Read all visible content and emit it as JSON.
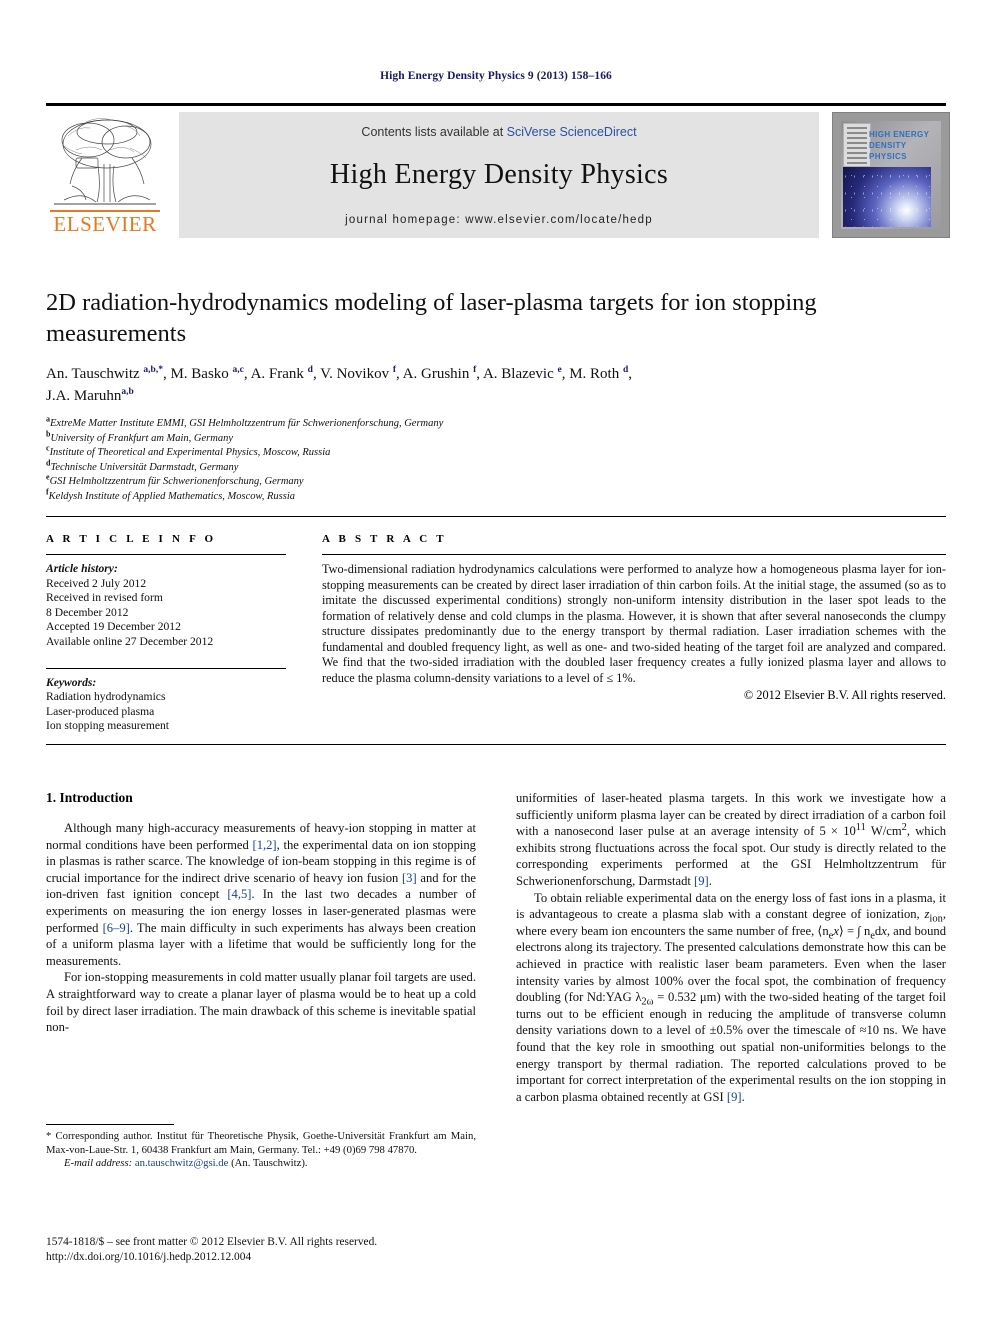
{
  "running_head": "High Energy Density Physics 9 (2013) 158–166",
  "masthead": {
    "contents_prefix": "Contents lists available at ",
    "sciencedirect": "SciVerse ScienceDirect",
    "journal_name": "High Energy Density Physics",
    "homepage": "journal homepage: www.elsevier.com/locate/hedp",
    "publisher_logo_text": "ELSEVIER",
    "cover_title_line1": "HIGH ENERGY",
    "cover_title_line2": "DENSITY PHYSICS",
    "accent_orange": "#E87722",
    "link_blue": "#2a4fa2"
  },
  "article": {
    "title": "2D radiation-hydrodynamics modeling of laser-plasma targets for ion stopping measurements",
    "authors_line1_html": "An. Tauschwitz <sup>a,b,*</sup>, M. Basko <sup>a,c</sup>, A. Frank <sup>d</sup>, V. Novikov <sup>f</sup>, A. Grushin <sup>f</sup>, A. Blazevic <sup>e</sup>, M. Roth <sup>d</sup>,",
    "authors_line2_html": "J.A. Maruhn<sup>a,b</sup>",
    "affiliations": [
      {
        "mark": "a",
        "text": "ExtreMe Matter Institute EMMI, GSI Helmholtzzentrum für Schwerionenforschung, Germany"
      },
      {
        "mark": "b",
        "text": "University of Frankfurt am Main, Germany"
      },
      {
        "mark": "c",
        "text": "Institute of Theoretical and Experimental Physics, Moscow, Russia"
      },
      {
        "mark": "d",
        "text": "Technische Universität Darmstadt, Germany"
      },
      {
        "mark": "e",
        "text": "GSI Helmholtzzentrum für Schwerionenforschung, Germany"
      },
      {
        "mark": "f",
        "text": "Keldysh Institute of Applied Mathematics, Moscow, Russia"
      }
    ]
  },
  "article_info": {
    "heading": "A R T I C L E   I N F O",
    "history_label": "Article history:",
    "history": [
      "Received 2 July 2012",
      "Received in revised form",
      "8 December 2012",
      "Accepted 19 December 2012",
      "Available online 27 December 2012"
    ],
    "keywords_label": "Keywords:",
    "keywords": [
      "Radiation hydrodynamics",
      "Laser-produced plasma",
      "Ion stopping measurement"
    ]
  },
  "abstract": {
    "heading": "A B S T R A C T",
    "text": "Two-dimensional radiation hydrodynamics calculations were performed to analyze how a homogeneous plasma layer for ion-stopping measurements can be created by direct laser irradiation of thin carbon foils. At the initial stage, the assumed (so as to imitate the discussed experimental conditions) strongly non-uniform intensity distribution in the laser spot leads to the formation of relatively dense and cold clumps in the plasma. However, it is shown that after several nanoseconds the clumpy structure dissipates predominantly due to the energy transport by thermal radiation. Laser irradiation schemes with the fundamental and doubled frequency light, as well as one- and two-sided heating of the target foil are analyzed and compared. We find that the two-sided irradiation with the doubled laser frequency creates a fully ionized plasma layer and allows to reduce the plasma column-density variations to a level of ≤ 1%.",
    "copyright": "© 2012 Elsevier B.V. All rights reserved."
  },
  "body": {
    "section_heading": "1. Introduction",
    "left_paragraphs_html": [
      "Although many high-accuracy measurements of heavy-ion stopping in matter at normal conditions have been performed <span class=\"ref\">[1,2]</span>, the experimental data on ion stopping in plasmas is rather scarce. The knowledge of ion-beam stopping in this regime is of crucial importance for the indirect drive scenario of heavy ion fusion <span class=\"ref\">[3]</span> and for the ion-driven fast ignition concept <span class=\"ref\">[4,5]</span>. In the last two decades a number of experiments on measuring the ion energy losses in laser-generated plasmas were performed <span class=\"ref\">[6&ndash;9]</span>. The main difficulty in such experiments has always been creation of a uniform plasma layer with a lifetime that would be sufficiently long for the measurements.",
      "For ion-stopping measurements in cold matter usually planar foil targets are used. A straightforward way to create a planar layer of plasma would be to heat up a cold foil by direct laser irradiation. The main drawback of this scheme is inevitable spatial non-"
    ],
    "right_paragraphs_html": [
      "uniformities of laser-heated plasma targets. In this work we investigate how a sufficiently uniform plasma layer can be created by direct irradiation of a carbon foil with a nanosecond laser pulse at an average intensity of 5 &times; 10<sup>11</sup> W/cm<sup>2</sup>, which exhibits strong fluctuations across the focal spot. Our study is directly related to the corresponding experiments performed at the GSI Helmholtzzentrum f&uuml;r Schwerionenforschung, Darmstadt <span class=\"ref\">[9]</span>.",
      "To obtain reliable experimental data on the energy loss of fast ions in a plasma, it is advantageous to create a plasma slab with a constant degree of ionization, <i>z</i><sub>ion</sub>, where every beam ion encounters the same number of free, &#10216;n<sub>e</sub><i>x</i>&#10217; = &#8747; n<sub>e</sub>d<i>x</i>, and bound electrons along its trajectory. The presented calculations demonstrate how this can be achieved in practice with realistic laser beam parameters. Even when the laser intensity varies by almost 100% over the focal spot, the combination of frequency doubling (for Nd:YAG &lambda;<sub>2&omega;</sub> = 0.532 &mu;m) with the two-sided heating of the target foil turns out to be efficient enough in reducing the amplitude of transverse column density variations down to a level of &plusmn;0.5% over the timescale of &asymp;10 ns. We have found that the key role in smoothing out spatial non-uniformities belongs to the energy transport by thermal radiation. The reported calculations proved to be important for correct interpretation of the experimental results on the ion stopping in a carbon plasma obtained recently at GSI <span class=\"ref\">[9]</span>."
    ]
  },
  "footnotes": {
    "corresponding_html": "* Corresponding author. Institut f&uuml;r Theoretische Physik, Goethe-Universit&auml;t Frankfurt am Main, Max-von-Laue-Str. 1, 60438 Frankfurt am Main, Germany. Tel.: +49 (0)69 798 47870.",
    "email_label": "E-mail address:",
    "email": "an.tauschwitz@gsi.de",
    "email_owner": "(An. Tauschwitz).",
    "imprint_line": "1574-1818/$ – see front matter © 2012 Elsevier B.V. All rights reserved.",
    "doi": "http://dx.doi.org/10.1016/j.hedp.2012.12.004"
  }
}
